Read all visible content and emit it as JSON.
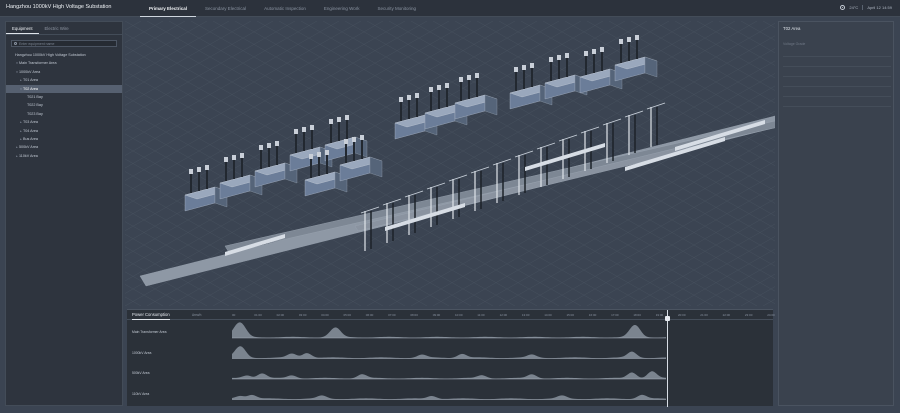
{
  "app": {
    "title": "Hangzhou 1000kV High Voltage Substation"
  },
  "nav": {
    "tabs": [
      {
        "label": "Primary Electrical",
        "active": true
      },
      {
        "label": "Secondary Electrical",
        "active": false
      },
      {
        "label": "Automatic Inspection",
        "active": false
      },
      {
        "label": "Engineering Work",
        "active": false
      },
      {
        "label": "Security Monitoring",
        "active": false
      }
    ]
  },
  "status": {
    "temperature": "24°C",
    "datetime": "April 12 14:59"
  },
  "left_panel": {
    "tabs": [
      {
        "label": "Equipment",
        "active": true
      },
      {
        "label": "Electric Wire",
        "active": false
      }
    ],
    "search": {
      "placeholder": "Enter equipment name",
      "value": ""
    },
    "tree": [
      {
        "label": "Hangzhou 1000kV High Voltage Substation",
        "depth": 0,
        "toggle": ""
      },
      {
        "label": "Main Transformer Area",
        "depth": 1,
        "toggle": "▾"
      },
      {
        "label": "1000kV Area",
        "depth": 1,
        "toggle": "▾"
      },
      {
        "label": "T01 Area",
        "depth": 2,
        "toggle": "▸"
      },
      {
        "label": "T02 Area",
        "depth": 2,
        "toggle": "▾",
        "selected": true
      },
      {
        "label": "T021 Bay",
        "depth": 3,
        "toggle": ""
      },
      {
        "label": "T022 Bay",
        "depth": 3,
        "toggle": ""
      },
      {
        "label": "T023 Bay",
        "depth": 3,
        "toggle": ""
      },
      {
        "label": "T03 Area",
        "depth": 2,
        "toggle": "▸"
      },
      {
        "label": "T04 Area",
        "depth": 2,
        "toggle": "▸"
      },
      {
        "label": "Bus Area",
        "depth": 2,
        "toggle": "▸"
      },
      {
        "label": "500kV Area",
        "depth": 1,
        "toggle": "▸"
      },
      {
        "label": "110kV Area",
        "depth": 1,
        "toggle": "▸"
      }
    ]
  },
  "timeline": {
    "title": "Power Consumption",
    "label_col": "Area/h",
    "ticks": [
      "00",
      "01:00",
      "02:00",
      "03:00",
      "04:00",
      "05:00",
      "06:00",
      "07:00",
      "08:00",
      "09:00",
      "10:00",
      "11:00",
      "12:00",
      "13:00",
      "14:00",
      "15:00",
      "16:00",
      "17:00",
      "18:00",
      "19:00",
      "20:00",
      "21:00",
      "22:00",
      "23:00",
      "24:00"
    ],
    "rows": [
      {
        "label": "Main Transformer Area"
      },
      {
        "label": "1000kV Area"
      },
      {
        "label": "500kV Area"
      },
      {
        "label": "110kV Area"
      }
    ]
  },
  "right_panel": {
    "title": "T02 Area",
    "subtitle": "Voltage Grade"
  },
  "colors": {
    "accent": "#dfe4ea",
    "panel": "#2e343e",
    "background": "#3b4452"
  }
}
